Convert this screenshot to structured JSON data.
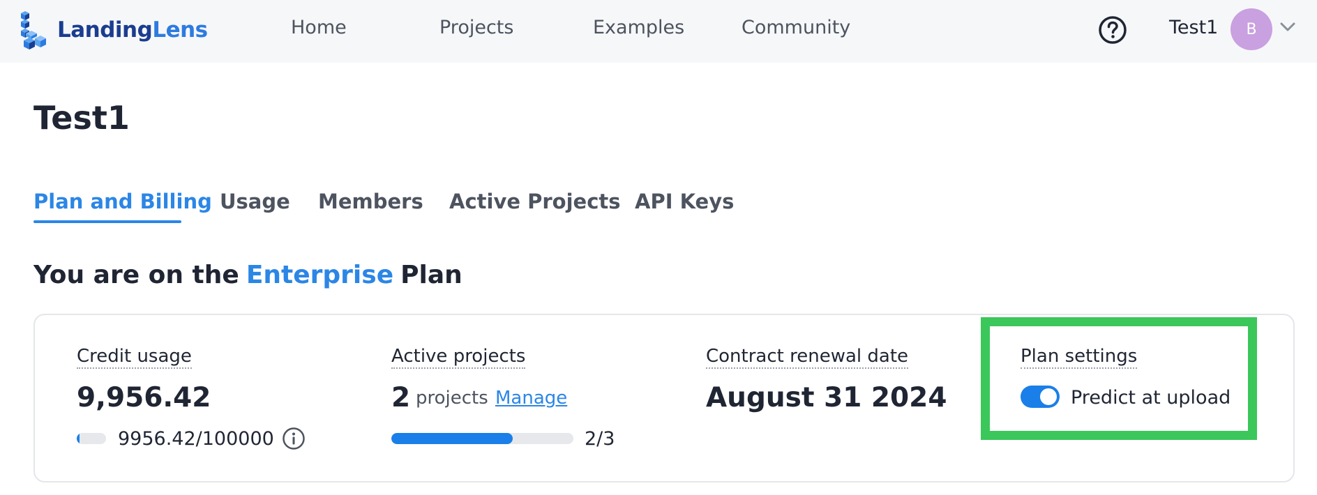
{
  "header": {
    "logo": {
      "part1": "Landing",
      "part2": "Lens"
    },
    "nav": [
      "Home",
      "Projects",
      "Examples",
      "Community"
    ],
    "user_name": "Test1",
    "avatar_initial": "B"
  },
  "page": {
    "title": "Test1",
    "tabs": [
      "Plan and Billing",
      "Usage",
      "Members",
      "Active Projects",
      "API Keys"
    ],
    "active_tab": "Plan and Billing"
  },
  "plan": {
    "prefix": "You are on the",
    "name": "Enterprise",
    "suffix": "Plan"
  },
  "stats": {
    "credit_usage": {
      "label": "Credit usage",
      "value": "9,956.42",
      "bar_text": "9956.42/100000",
      "used_fraction": 0.0996
    },
    "active_projects": {
      "label": "Active projects",
      "value": "2",
      "suffix": "projects",
      "link": "Manage",
      "bar_text": "2/3",
      "used_fraction": 0.667
    },
    "renewal": {
      "label": "Contract renewal date",
      "value": "August 31 2024"
    },
    "plan_settings": {
      "label": "Plan settings",
      "toggle_label": "Predict at upload",
      "toggle_on": true
    }
  },
  "colors": {
    "accent": "#2b86e6",
    "progress": "#1a7fe8",
    "highlight": "#3bc75a",
    "avatar": "#c9a0e0"
  },
  "icons": [
    "logo-cubes-icon",
    "help-circle-icon",
    "chevron-down-icon",
    "info-circle-icon"
  ]
}
